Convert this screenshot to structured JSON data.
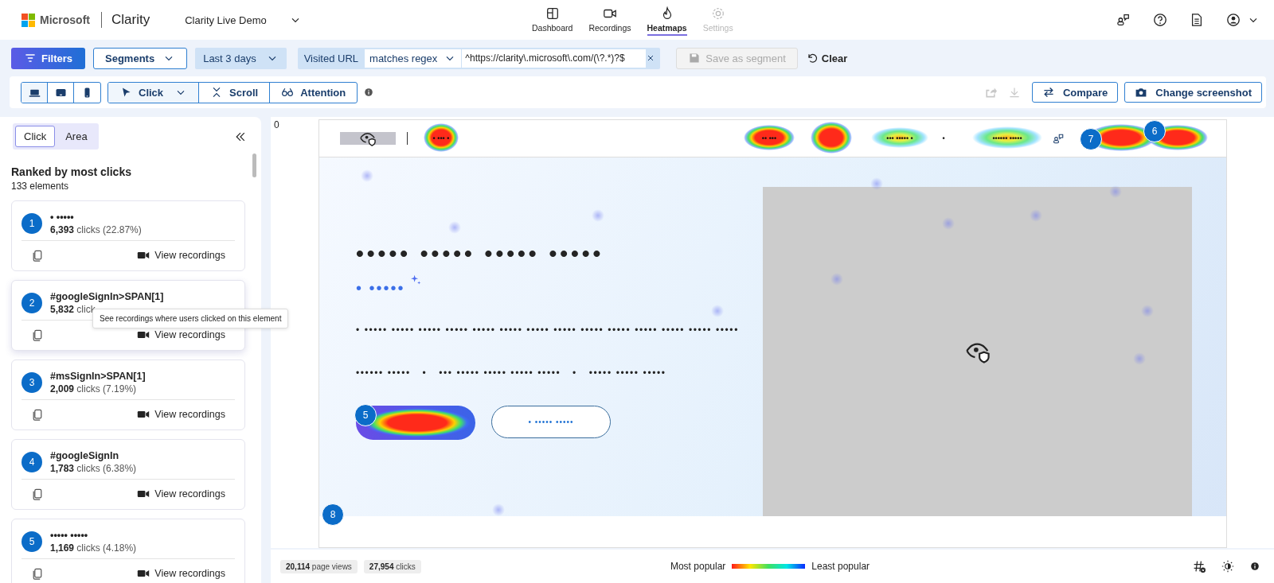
{
  "header": {
    "company": "Microsoft",
    "product": "Clarity",
    "project": "Clarity Live Demo",
    "nav": [
      {
        "label": "Dashboard",
        "kind": "dashboard",
        "selected": false,
        "disabled": false
      },
      {
        "label": "Recordings",
        "kind": "recordings",
        "selected": false,
        "disabled": false
      },
      {
        "label": "Heatmaps",
        "kind": "heatmaps",
        "selected": true,
        "disabled": false
      },
      {
        "label": "Settings",
        "kind": "settings",
        "selected": false,
        "disabled": true
      }
    ]
  },
  "filter_bar": {
    "filters": "Filters",
    "segments": "Segments",
    "date_range": "Last 3 days",
    "url_filter": {
      "label": "Visited URL",
      "operator": "matches regex",
      "value": "^https://clarity\\.microsoft\\.com/(\\?.*)?$"
    },
    "save_segment": {
      "label": "Save as segment",
      "disabled": true
    },
    "clear": "Clear"
  },
  "toolbar": {
    "devices": [
      {
        "kind": "desktop",
        "selected": true
      },
      {
        "kind": "tablet",
        "selected": false
      },
      {
        "kind": "mobile",
        "selected": false
      }
    ],
    "modes": [
      {
        "label": "Click",
        "kind": "click",
        "selected": true
      },
      {
        "label": "Scroll",
        "kind": "scroll",
        "selected": false
      },
      {
        "label": "Attention",
        "kind": "attention",
        "selected": false
      }
    ],
    "share_disabled": true,
    "download_disabled": true,
    "compare": "Compare",
    "change_screenshot": "Change screenshot"
  },
  "panel": {
    "tabs": [
      {
        "label": "Click",
        "selected": true
      },
      {
        "label": "Area",
        "selected": false
      }
    ],
    "heading": "Ranked by most clicks",
    "count": "133 elements",
    "elements": [
      {
        "rank": "1",
        "name": "• •••••",
        "clicks": "**6,393** clicks (22.87%)",
        "action": "View recordings"
      },
      {
        "rank": "2",
        "name": "#googleSignIn>SPAN[1]",
        "clicks": "**5,832** click",
        "action": "View recordings"
      },
      {
        "rank": "3",
        "name": "#msSignIn>SPAN[1]",
        "clicks": "**2,009** clicks (7.19%)",
        "action": "View recordings"
      },
      {
        "rank": "4",
        "name": "#googleSignIn",
        "clicks": "**1,783** clicks (6.38%)",
        "action": "View recordings"
      },
      {
        "rank": "5",
        "name": "••••• •••••",
        "clicks": "**1,169** clicks (4.18%)",
        "action": "View recordings"
      }
    ],
    "tooltip": "See recordings where users clicked on this element"
  },
  "heatmap": {
    "ruler": "0",
    "nav_items": [
      "• ••• •",
      "•• •••",
      "••• ••••• •",
      "•",
      "•••••• •••••"
    ],
    "headline": "••••• ••••• ••••• •••••",
    "subtitle": "• •••••",
    "paragraph": "• ••••• ••••• ••••• ••••• ••••• ••••• ••••• ••••• ••••• ••••• ••••• ••••• ••••• •••••",
    "meta": "•••••• •••••   •   ••• ••••• ••••• ••••• •••••   •   ••••• ••••• •••••",
    "secondary_button": "• ••••• •••••",
    "markers": [
      "5",
      "6",
      "7",
      "8"
    ]
  },
  "footer": {
    "stats": [
      "**20,114** page views",
      "**27,954** clicks"
    ],
    "most": "Most popular",
    "least": "Least popular"
  }
}
